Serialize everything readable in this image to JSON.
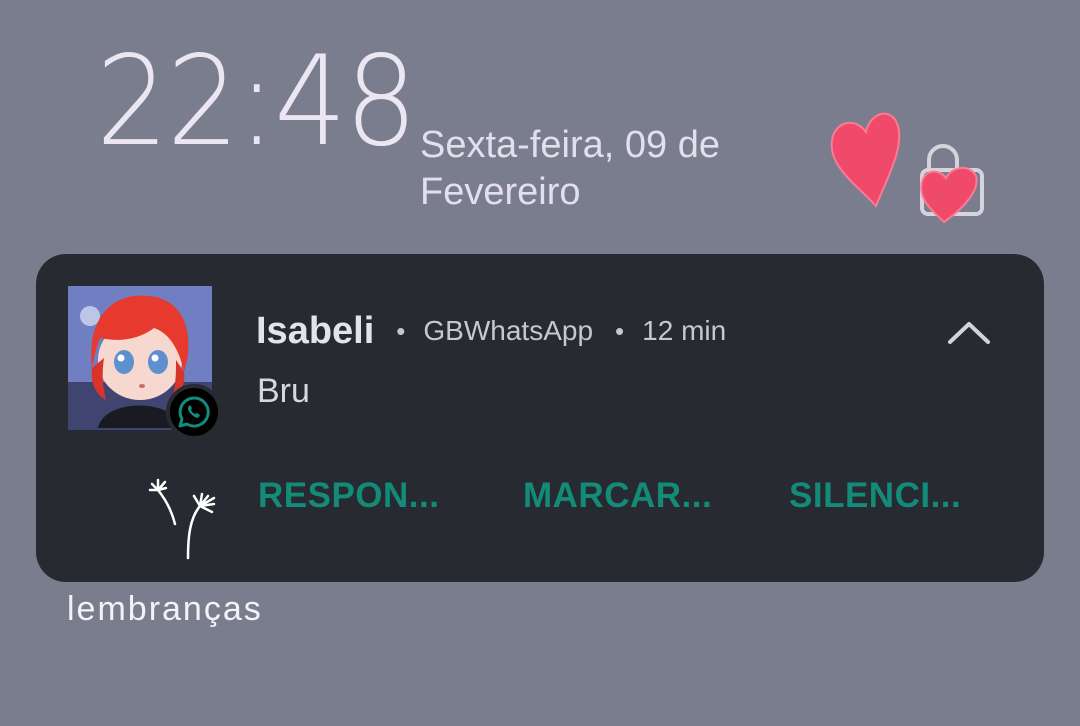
{
  "lockscreen": {
    "time": "22:48",
    "date": "Sexta-feira, 09 de Fevereiro"
  },
  "notification": {
    "sender": "Isabeli",
    "app": "GBWhatsApp",
    "time_ago": "12 min",
    "message": "Bru",
    "actions": [
      {
        "label": "RESPON..."
      },
      {
        "label": "MARCAR..."
      },
      {
        "label": "SILENCI..."
      }
    ]
  },
  "caption": "lembranças",
  "colors": {
    "background": "#797d8d",
    "card": "#272a30",
    "action_text": "#128b78",
    "heart": "#f04a6a",
    "whatsapp_green": "#128c7e"
  },
  "icons": {
    "expand": "chevron-up-icon",
    "app_badge": "whatsapp-icon",
    "decoration": "heart-icon",
    "sticker": "dandelion-icon",
    "lock": "lock-icon"
  }
}
